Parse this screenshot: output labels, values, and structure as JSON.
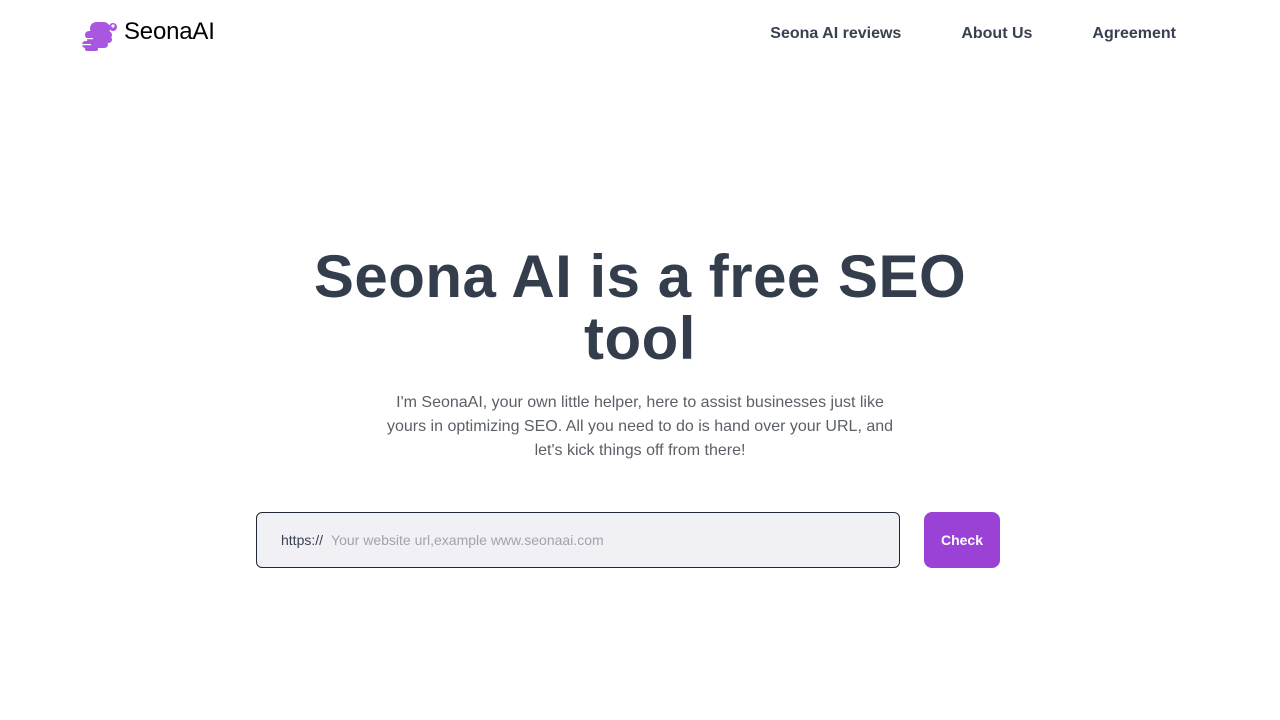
{
  "brand": {
    "name": "SeonaAI",
    "logo_icon": "snake-icon",
    "logo_color": "#a956e0"
  },
  "nav": {
    "items": [
      {
        "label": "Seona AI reviews"
      },
      {
        "label": "About Us"
      },
      {
        "label": "Agreement"
      }
    ]
  },
  "hero": {
    "title": "Seona AI is a free SEO tool",
    "subtitle": "I'm SeonaAI, your own little helper, here to assist businesses just like yours in optimizing SEO. All you need to do is hand over your URL, and let's kick things off from there!"
  },
  "search": {
    "prefix": "https://",
    "value": "",
    "placeholder": "Your website url,example www.seonaai.com",
    "button_label": "Check"
  },
  "colors": {
    "accent": "#9a42d6",
    "title_text": "#333d4b",
    "nav_text": "#374151",
    "input_bg": "#f1f1f5"
  }
}
